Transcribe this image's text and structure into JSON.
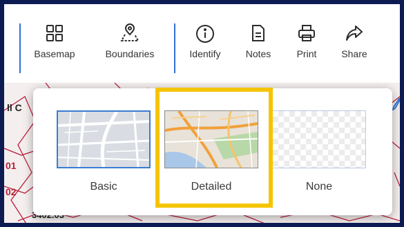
{
  "toolbar": {
    "basemap_label": "Basemap",
    "boundaries_label": "Boundaries",
    "identify_label": "Identify",
    "notes_label": "Notes",
    "print_label": "Print",
    "share_label": "Share"
  },
  "map": {
    "left_labels": [
      "ll C",
      "01",
      "02"
    ],
    "bottom_label": "3402.03"
  },
  "basemap_popup": {
    "options": [
      {
        "label": "Basic",
        "selected": true
      },
      {
        "label": "Detailed",
        "selected": false
      },
      {
        "label": "None",
        "selected": false
      }
    ],
    "highlighted_option": "Detailed"
  },
  "colors": {
    "frame": "#0c1b52",
    "accent": "#3a7bd5",
    "highlight": "#f5c400",
    "boundary_lines": "#b81f3a"
  }
}
